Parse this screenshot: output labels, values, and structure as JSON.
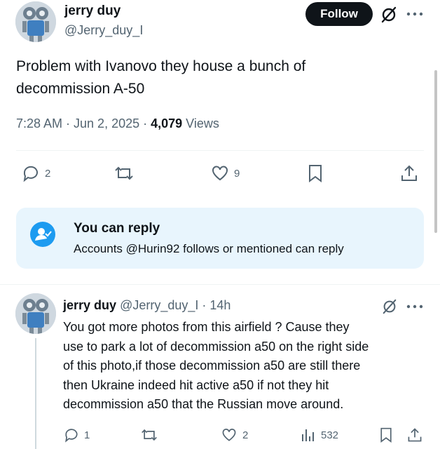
{
  "main_post": {
    "author_name": "jerry duy",
    "author_handle": "@Jerry_duy_I",
    "follow_label": "Follow",
    "text_line1": "Problem with Ivanovo they house a bunch of",
    "text_line2": "decommission A-50",
    "timestamp": "7:28 AM · Jun 2, 2025 · ",
    "views_count": "4,079",
    "views_label": " Views",
    "replies": "2",
    "likes": "9"
  },
  "reply_notice": {
    "title": "You can reply",
    "subtitle": "Accounts @Hurin92 follows or mentioned can reply"
  },
  "reply_post": {
    "author_name": "jerry duy",
    "author_handle": "@Jerry_duy_I",
    "time": "· 14h",
    "lines": [
      "You got more photos from this airfield ? Cause they",
      "use to park a lot of decommission a50 on the right side",
      "of this photo,if those decommission a50 are still there",
      "then Ukraine indeed hit active a50 if not they hit",
      "decommission a50 that the Russian move around."
    ],
    "replies": "1",
    "likes": "2",
    "views": "532"
  },
  "colors": {
    "accent": "#1d9bf0",
    "text": "#0f1419",
    "muted": "#536471",
    "notice_bg": "#e8f5fd"
  }
}
